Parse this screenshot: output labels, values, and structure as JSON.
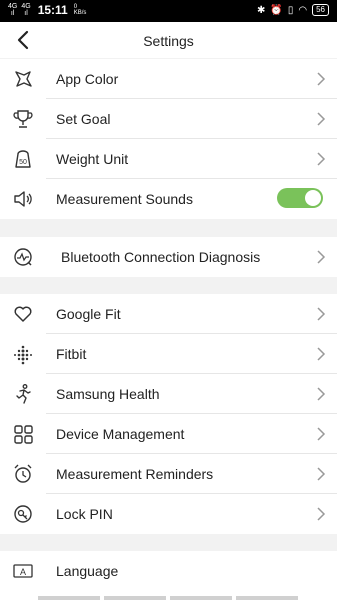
{
  "status_bar": {
    "signal1": "4G",
    "signal1_sub": "ıl",
    "signal2": "4G",
    "signal2_sub": "ıl",
    "time": "15:11",
    "speed_value": "0",
    "speed_unit": "KB/s",
    "battery": "56"
  },
  "header": {
    "title": "Settings"
  },
  "settings": {
    "app_color": "App Color",
    "set_goal": "Set Goal",
    "weight_unit": "Weight Unit",
    "measurement_sounds": "Measurement Sounds",
    "measurement_sounds_on": true,
    "bluetooth": "Bluetooth Connection Diagnosis",
    "google_fit": "Google Fit",
    "fitbit": "Fitbit",
    "samsung_health": "Samsung Health",
    "device_management": "Device Management",
    "measurement_reminders": "Measurement Reminders",
    "lock_pin": "Lock PIN",
    "language": "Language"
  },
  "icons": {
    "weight_badge": "50",
    "language_badge": "A"
  },
  "colors": {
    "toggle_on": "#7ac25a",
    "section_gap": "#f2f2f2"
  }
}
